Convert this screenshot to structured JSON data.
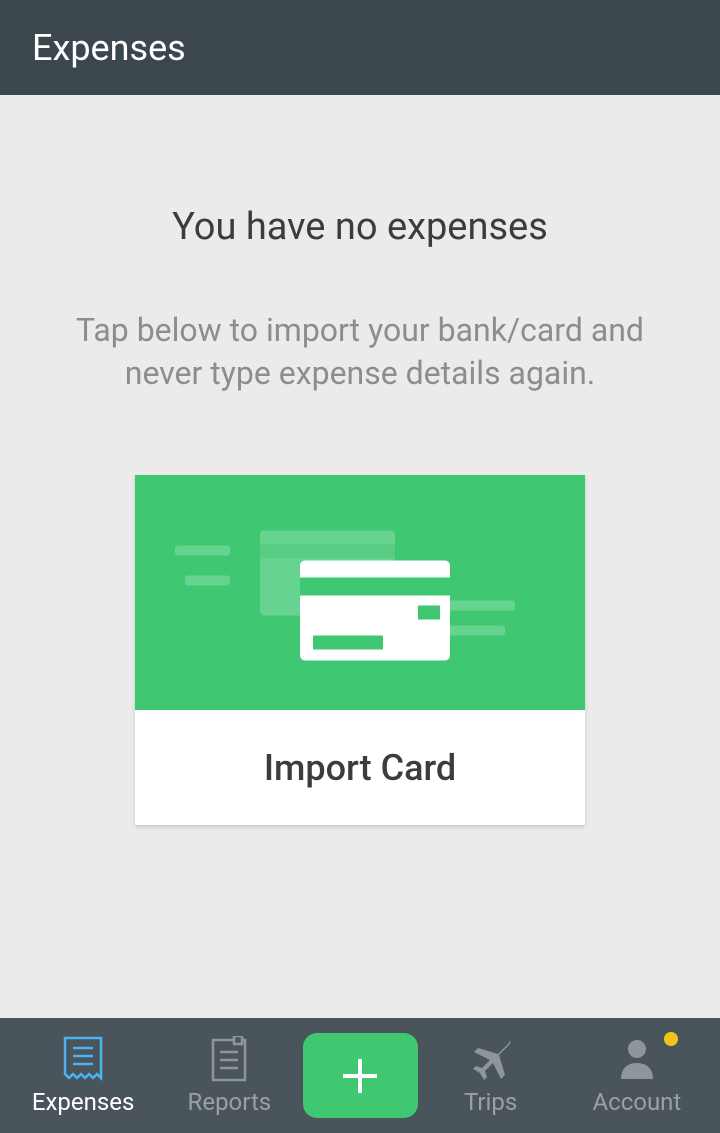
{
  "header": {
    "title": "Expenses"
  },
  "empty_state": {
    "title": "You have no expenses",
    "subtitle": "Tap below to import your bank/card and never type expense details again."
  },
  "import_card": {
    "label": "Import Card"
  },
  "nav": {
    "expenses": "Expenses",
    "reports": "Reports",
    "trips": "Trips",
    "account": "Account"
  }
}
